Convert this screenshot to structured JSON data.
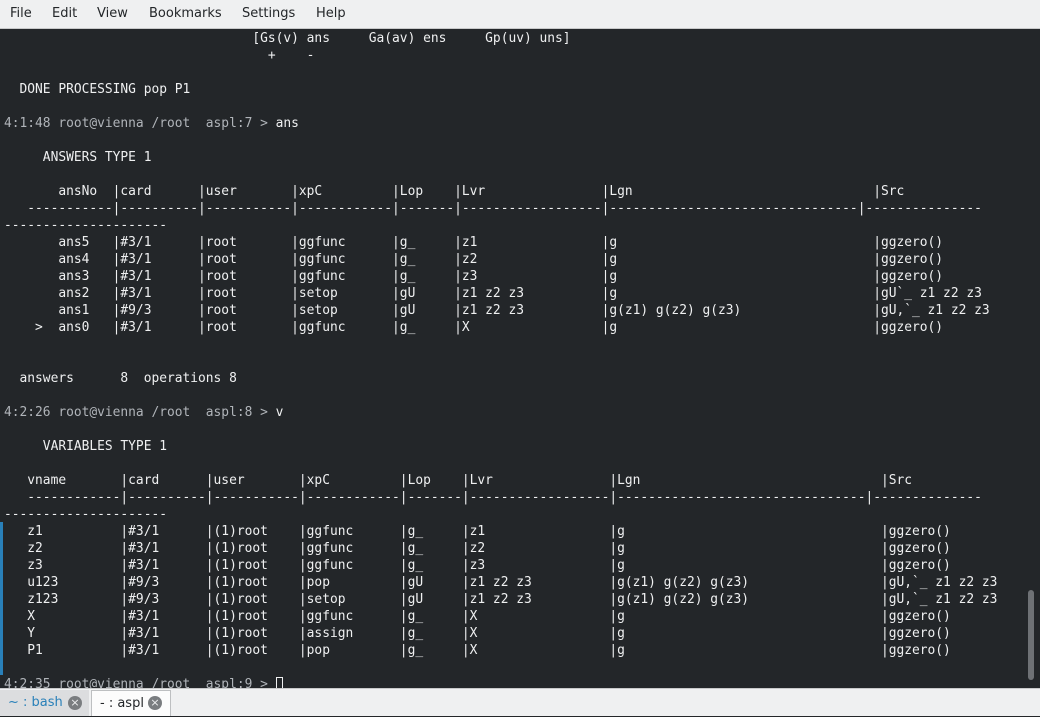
{
  "menubar": {
    "items": [
      "File",
      "Edit",
      "View",
      "Bookmarks",
      "Settings",
      "Help"
    ]
  },
  "terminal": {
    "lines": [
      {
        "p": "",
        "t": "                                [Gs(v) ans     Ga(av) ens     Gp(uv) uns]"
      },
      {
        "p": "",
        "t": "                                  +    -"
      },
      {
        "p": "",
        "t": ""
      },
      {
        "p": "",
        "t": "  DONE PROCESSING pop P1"
      },
      {
        "p": "",
        "t": ""
      },
      {
        "p": "4:1:48 root@vienna /root  aspl:7 > ",
        "t": "ans"
      },
      {
        "p": "",
        "t": ""
      },
      {
        "p": "",
        "t": "     ANSWERS TYPE 1"
      },
      {
        "p": "",
        "t": ""
      },
      {
        "p": "",
        "t": "       ansNo  |card      |user       |xpC         |Lop    |Lvr               |Lgn                               |Src"
      },
      {
        "p": "",
        "t": "   -----------|----------|-----------|------------|-------|------------------|--------------------------------|---------------"
      },
      {
        "p": "",
        "t": "---------------------"
      },
      {
        "p": "",
        "t": "       ans5   |#3/1      |root       |ggfunc      |g_     |z1                |g                                 |ggzero()"
      },
      {
        "p": "",
        "t": "       ans4   |#3/1      |root       |ggfunc      |g_     |z2                |g                                 |ggzero()"
      },
      {
        "p": "",
        "t": "       ans3   |#3/1      |root       |ggfunc      |g_     |z3                |g                                 |ggzero()"
      },
      {
        "p": "",
        "t": "       ans2   |#3/1      |root       |setop       |gU     |z1 z2 z3          |g                                 |gU`_ z1 z2 z3"
      },
      {
        "p": "",
        "t": "       ans1   |#9/3      |root       |setop       |gU     |z1 z2 z3          |g(z1) g(z2) g(z3)                 |gU,`_ z1 z2 z3"
      },
      {
        "p": "",
        "t": "    >  ans0   |#3/1      |root       |ggfunc      |g_     |X                 |g                                 |ggzero()"
      },
      {
        "p": "",
        "t": ""
      },
      {
        "p": "",
        "t": ""
      },
      {
        "p": "",
        "t": "  answers      8  operations 8"
      },
      {
        "p": "",
        "t": ""
      },
      {
        "p": "4:2:26 root@vienna /root  aspl:8 > ",
        "t": "v"
      },
      {
        "p": "",
        "t": ""
      },
      {
        "p": "",
        "t": "     VARIABLES TYPE 1"
      },
      {
        "p": "",
        "t": ""
      },
      {
        "p": "",
        "t": "   vname       |card      |user       |xpC         |Lop    |Lvr               |Lgn                               |Src"
      },
      {
        "p": "",
        "t": "   ------------|----------|-----------|------------|-------|------------------|--------------------------------|--------------"
      },
      {
        "p": "",
        "t": "---------------------"
      },
      {
        "p": "",
        "t": "   z1          |#3/1      |(1)root    |ggfunc      |g_     |z1                |g                                 |ggzero()"
      },
      {
        "p": "",
        "t": "   z2          |#3/1      |(1)root    |ggfunc      |g_     |z2                |g                                 |ggzero()"
      },
      {
        "p": "",
        "t": "   z3          |#3/1      |(1)root    |ggfunc      |g_     |z3                |g                                 |ggzero()"
      },
      {
        "p": "",
        "t": "   u123        |#9/3      |(1)root    |pop         |gU     |z1 z2 z3          |g(z1) g(z2) g(z3)                 |gU,`_ z1 z2 z3"
      },
      {
        "p": "",
        "t": "   z123        |#9/3      |(1)root    |setop       |gU     |z1 z2 z3          |g(z1) g(z2) g(z3)                 |gU,`_ z1 z2 z3"
      },
      {
        "p": "",
        "t": "   X           |#3/1      |(1)root    |ggfunc      |g_     |X                 |g                                 |ggzero()"
      },
      {
        "p": "",
        "t": "   Y           |#3/1      |(1)root    |assign      |g_     |X                 |g                                 |ggzero()"
      },
      {
        "p": "",
        "t": "   P1          |#3/1      |(1)root    |pop         |g_     |X                 |g                                 |ggzero()"
      },
      {
        "p": "",
        "t": ""
      },
      {
        "p": "4:2:35 root@vienna /root  aspl:9 > ",
        "t": "",
        "cursor": true
      }
    ]
  },
  "tabs": [
    {
      "label": "~ : bash",
      "close": "×"
    },
    {
      "label": "- : aspl",
      "close": "×"
    }
  ]
}
